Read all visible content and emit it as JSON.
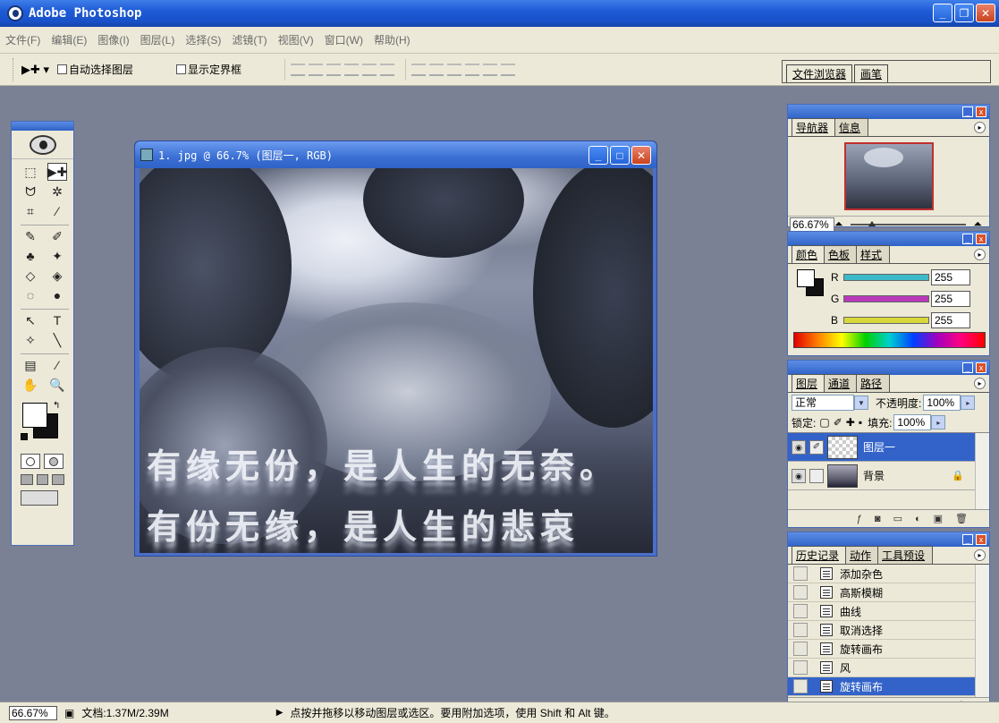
{
  "app": {
    "title": "Adobe Photoshop"
  },
  "window_buttons": {
    "minimize": "_",
    "restore": "❐",
    "close": "✕"
  },
  "menu": [
    "文件(F)",
    "编辑(E)",
    "图像(I)",
    "图层(L)",
    "选择(S)",
    "滤镜(T)",
    "视图(V)",
    "窗口(W)",
    "帮助(H)"
  ],
  "options": {
    "tool_glyph": "▶✚ ▾",
    "auto_select_label": "自动选择图层",
    "show_bounds_label": "显示定界框",
    "well_tabs": [
      "文件浏览器",
      "画笔"
    ]
  },
  "document": {
    "title": "1. jpg @ 66.7% (图层一, RGB)",
    "overlay_text_line1": "有缘无份，是人生的无奈。",
    "overlay_text_line2": "有份无缘，是人生的悲哀"
  },
  "tools": [
    "⬚",
    "▶✚",
    "ᗢ",
    "✲",
    "⌗",
    "⁄",
    "✎",
    "✐",
    "♣",
    "✦",
    "◇",
    "◈",
    "◌",
    "●",
    "↖",
    "T",
    "✧",
    "╲",
    "▤",
    "⁄",
    "✋",
    "🔍"
  ],
  "navigator": {
    "tabs": [
      "导航器",
      "信息"
    ],
    "zoom": "66.67%"
  },
  "color": {
    "tabs": [
      "颜色",
      "色板",
      "样式"
    ],
    "channels": [
      {
        "label": "R",
        "value": "255",
        "color": "#3cbac8"
      },
      {
        "label": "G",
        "value": "255",
        "color": "#b83ab8"
      },
      {
        "label": "B",
        "value": "255",
        "color": "#d8d83a"
      }
    ]
  },
  "layers": {
    "tabs": [
      "图层",
      "通道",
      "路径"
    ],
    "blend_mode": "正常",
    "opacity_label": "不透明度:",
    "opacity_value": "100%",
    "lock_label": "锁定:",
    "fill_label": "填充:",
    "fill_value": "100%",
    "items": [
      {
        "name": "图层一",
        "selected": true
      },
      {
        "name": "背景",
        "selected": false
      }
    ]
  },
  "history": {
    "tabs": [
      "历史记录",
      "动作",
      "工具预设"
    ],
    "items": [
      "添加杂色",
      "高斯模糊",
      "曲线",
      "取消选择",
      "旋转画布",
      "风",
      "旋转画布"
    ]
  },
  "status": {
    "zoom": "66.67%",
    "doc_info": "文档:1.37M/2.39M",
    "hint": "点按并拖移以移动图层或选区。要用附加选项，使用 Shift 和 Alt 键。"
  }
}
